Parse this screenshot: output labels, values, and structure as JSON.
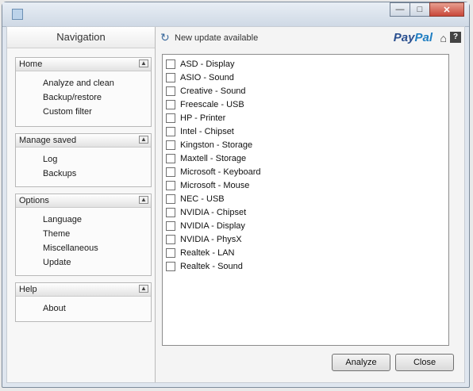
{
  "window": {
    "title": ""
  },
  "nav": {
    "title": "Navigation",
    "groups": [
      {
        "header": "Home",
        "items": [
          {
            "label": "Analyze and clean"
          },
          {
            "label": "Backup/restore"
          },
          {
            "label": "Custom filter"
          }
        ]
      },
      {
        "header": "Manage saved",
        "items": [
          {
            "label": "Log"
          },
          {
            "label": "Backups"
          }
        ]
      },
      {
        "header": "Options",
        "items": [
          {
            "label": "Language"
          },
          {
            "label": "Theme"
          },
          {
            "label": "Miscellaneous"
          },
          {
            "label": "Update"
          }
        ]
      },
      {
        "header": "Help",
        "items": [
          {
            "label": "About"
          }
        ]
      }
    ]
  },
  "topbar": {
    "update_text": "New update available",
    "paypal_a": "Pay",
    "paypal_b": "Pal"
  },
  "devices": [
    {
      "label": "ASD - Display"
    },
    {
      "label": "ASIO - Sound"
    },
    {
      "label": "Creative - Sound"
    },
    {
      "label": "Freescale - USB"
    },
    {
      "label": "HP - Printer"
    },
    {
      "label": "Intel - Chipset"
    },
    {
      "label": "Kingston - Storage"
    },
    {
      "label": "Maxtell - Storage"
    },
    {
      "label": "Microsoft - Keyboard"
    },
    {
      "label": "Microsoft - Mouse"
    },
    {
      "label": "NEC - USB"
    },
    {
      "label": "NVIDIA - Chipset"
    },
    {
      "label": "NVIDIA - Display"
    },
    {
      "label": "NVIDIA - PhysX"
    },
    {
      "label": "Realtek - LAN"
    },
    {
      "label": "Realtek - Sound"
    }
  ],
  "buttons": {
    "analyze": "Analyze",
    "close": "Close"
  }
}
